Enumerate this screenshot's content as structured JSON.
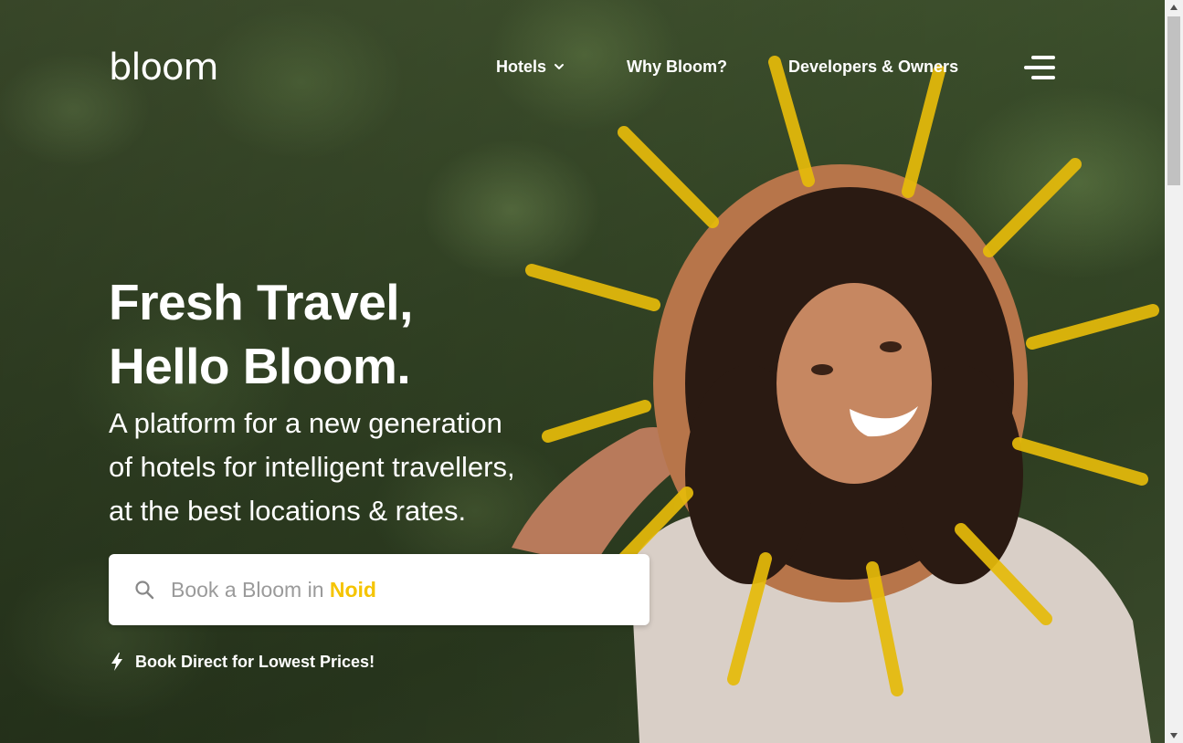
{
  "brand": {
    "logo": "bloom",
    "accent": "#F5C400"
  },
  "nav": {
    "hotels": "Hotels",
    "why": "Why Bloom?",
    "developers": "Developers & Owners"
  },
  "hero": {
    "headline": [
      "Fresh Travel,",
      "Hello Bloom."
    ],
    "sub": [
      "A platform for a new generation",
      "of hotels for intelligent travellers,",
      "at the best locations & rates."
    ]
  },
  "search": {
    "prefix": "Book a Bloom in ",
    "city": "Noid"
  },
  "promo": {
    "text": "Book Direct for Lowest Prices!"
  },
  "icons": [
    "chevron-down-icon",
    "menu-icon",
    "search-icon",
    "lightning-bolt-icon"
  ]
}
